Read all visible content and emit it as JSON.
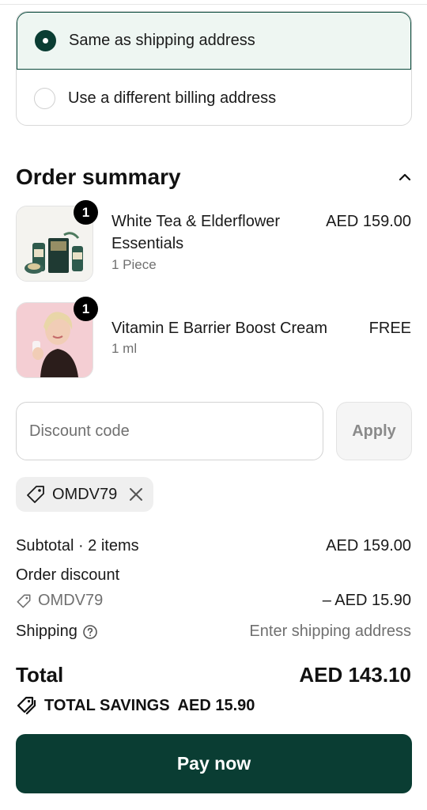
{
  "billing": {
    "options": [
      {
        "label": "Same as shipping address",
        "selected": true
      },
      {
        "label": "Use a different billing address",
        "selected": false
      }
    ]
  },
  "order_summary": {
    "title": "Order summary",
    "items": [
      {
        "name_line1": "White Tea & Elderflower",
        "name_line2": "Essentials",
        "variant": "1 Piece",
        "price": "AED 159.00",
        "quantity": "1"
      },
      {
        "name_line1": "Vitamin E Barrier Boost Cream",
        "variant": "1 ml",
        "price": "FREE",
        "quantity": "1"
      }
    ]
  },
  "discount": {
    "placeholder": "Discount code",
    "apply_label": "Apply",
    "applied_code": "OMDV79"
  },
  "totals": {
    "subtotal_label": "Subtotal · 2 items",
    "subtotal_value": "AED 159.00",
    "order_discount_label": "Order discount",
    "discount_code": "OMDV79",
    "discount_value": "– AED 15.90",
    "shipping_label": "Shipping",
    "shipping_value": "Enter shipping address",
    "total_label": "Total",
    "total_value": "AED 143.10",
    "savings_label": "TOTAL SAVINGS",
    "savings_value": "AED 15.90"
  },
  "pay_button": "Pay now",
  "colors": {
    "brand": "#0a3d33",
    "selected_bg": "#eef6f2",
    "muted_text": "#707070"
  }
}
